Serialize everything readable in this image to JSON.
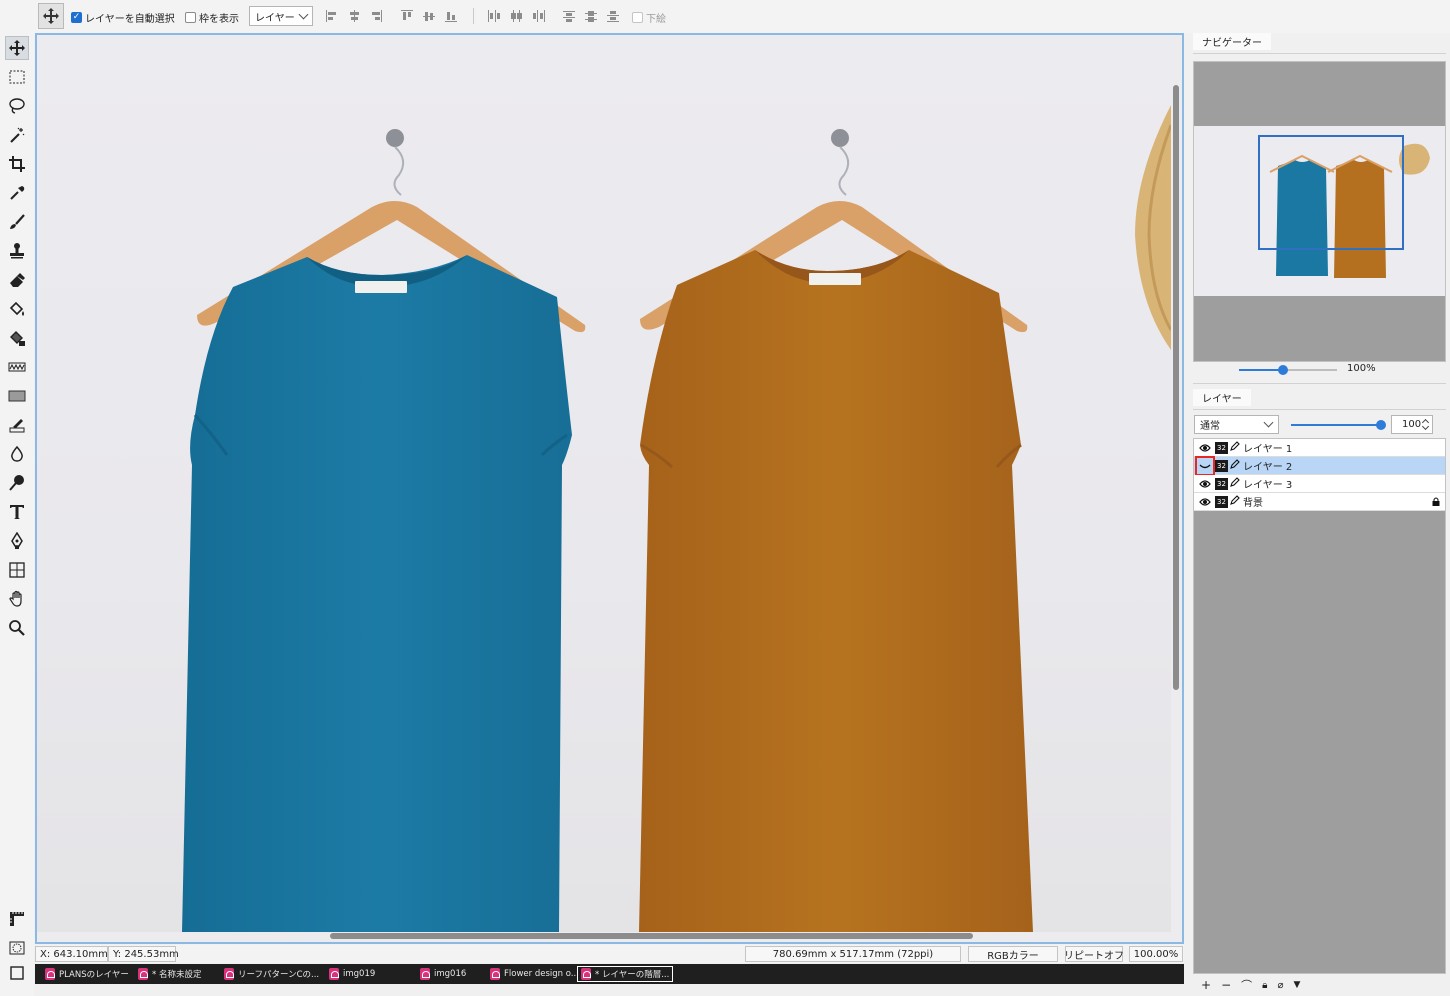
{
  "optionbar": {
    "auto_select_label": "レイヤーを自動選択",
    "auto_select_checked": true,
    "show_bounds_label": "枠を表示",
    "show_bounds_checked": false,
    "mode_select_value": "レイヤー",
    "underlay_label": "下絵",
    "underlay_checked": false
  },
  "tools": [
    "move-icon",
    "rect-select-icon",
    "lasso-icon",
    "magic-wand-icon",
    "crop-icon",
    "eyedropper-icon",
    "brush-icon",
    "stamp-icon",
    "eraser-icon",
    "fill-bucket-icon",
    "gradient-fill-icon",
    "wave-icon",
    "rectangle-icon",
    "smudge-icon",
    "blur-drop-icon",
    "dodge-icon",
    "text-icon",
    "pen-icon",
    "transform-icon",
    "hand-icon",
    "zoom-icon"
  ],
  "bottom_tools": [
    "ruler-icon",
    "quick-mask-icon",
    "screen-mode-icon"
  ],
  "status": {
    "x": "X:  643.10mm",
    "y": "Y:  245.53mm",
    "size": "780.69mm x 517.17mm (72ppi)",
    "color_mode": "RGBカラー",
    "repeat": "リピートオフ",
    "zoom": "100.00%"
  },
  "doc_tabs": [
    {
      "label": "PLANSのレイヤー"
    },
    {
      "label": "* 名称未設定"
    },
    {
      "label": "リーフパターンCの..."
    },
    {
      "label": "img019"
    },
    {
      "label": "img016"
    },
    {
      "label": "Flower design o..."
    },
    {
      "label": "* レイヤーの階層..."
    }
  ],
  "navigator": {
    "tab_label": "ナビゲーター",
    "zoom_label": "100%",
    "zoom_fraction": 0.45
  },
  "layers_panel": {
    "tab_label": "レイヤー",
    "blend_mode": "通常",
    "opacity": "100",
    "opacity_fraction": 1.0,
    "rows": [
      {
        "bits": "32",
        "name": "レイヤー 1",
        "visible": true,
        "selected": false,
        "locked": false
      },
      {
        "bits": "32",
        "name": "レイヤー 2",
        "visible": false,
        "selected": true,
        "locked": false
      },
      {
        "bits": "32",
        "name": "レイヤー 3",
        "visible": true,
        "selected": false,
        "locked": false
      },
      {
        "bits": "32",
        "name": "背景",
        "visible": true,
        "selected": false,
        "locked": true
      }
    ],
    "footer": [
      "add-layer-icon",
      "delete-layer-icon",
      "link-icon",
      "lock-icon",
      "clip-icon",
      "menu-down-icon"
    ]
  },
  "colors": {
    "accent": "#2f7bd8",
    "shirt_blue": "#1c7aa3",
    "shirt_brown": "#b4701f",
    "highlight": "#e8281f"
  }
}
